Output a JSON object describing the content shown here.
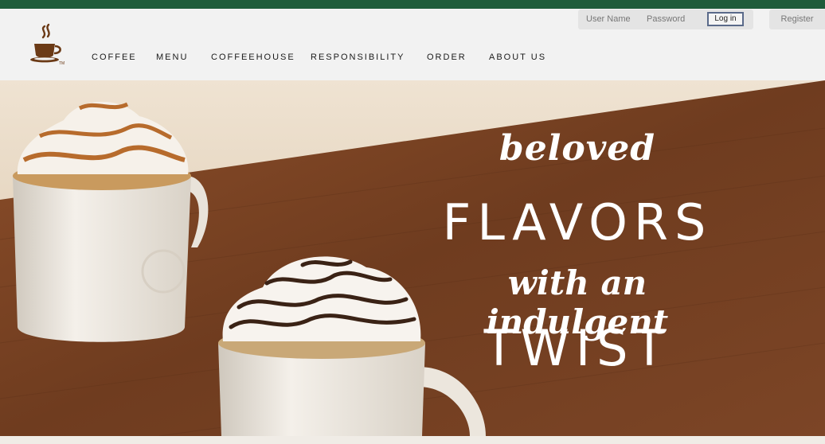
{
  "header": {
    "logo": "coffee-cup-logo",
    "nav": [
      {
        "label": "COFFEE"
      },
      {
        "label": "MENU"
      },
      {
        "label": "COFFEEHOUSE"
      },
      {
        "label": "RESPONSIBILITY"
      },
      {
        "label": "ORDER"
      },
      {
        "label": "ABOUT US"
      }
    ],
    "login": {
      "username_placeholder": "User Name",
      "password_placeholder": "Password",
      "login_label": "Log in",
      "register_label": "Register"
    }
  },
  "hero": {
    "line1": "beloved",
    "line2": "FLAVORS",
    "line3": "with an indulgent",
    "line4": "TWIST"
  },
  "colors": {
    "top_bar": "#1f5c3b",
    "header_bg": "#f2f2f2",
    "brand_brown": "#6b3a16",
    "wood": "#7a4424"
  }
}
